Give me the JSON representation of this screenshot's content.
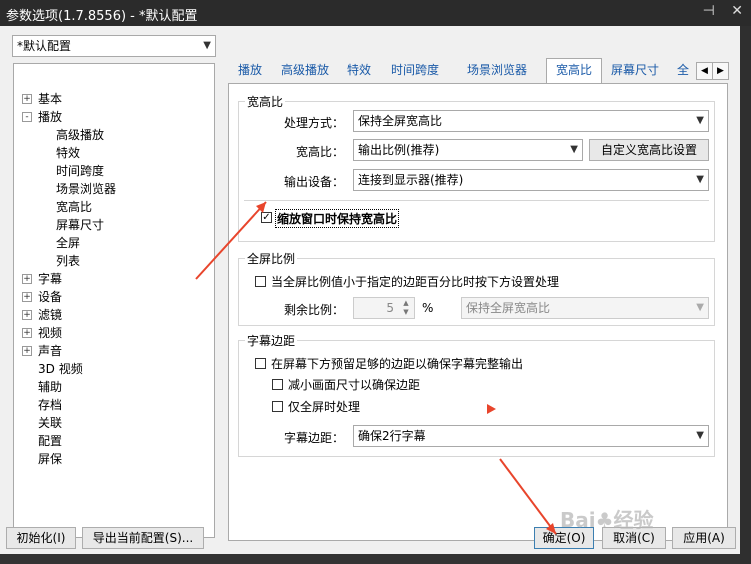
{
  "window": {
    "title": "参数选项(1.7.8556) - *默认配置",
    "pin_icon": "pin-icon",
    "close_icon": "close-icon"
  },
  "profile": {
    "selected": "*默认配置"
  },
  "tree": [
    {
      "label": "基本",
      "expander": "+"
    },
    {
      "label": "播放",
      "expander": "-"
    },
    {
      "label": "高级播放"
    },
    {
      "label": "特效"
    },
    {
      "label": "时间跨度"
    },
    {
      "label": "场景浏览器"
    },
    {
      "label": "宽高比"
    },
    {
      "label": "屏幕尺寸"
    },
    {
      "label": "全屏"
    },
    {
      "label": "列表"
    },
    {
      "label": "字幕",
      "expander": "+"
    },
    {
      "label": "设备",
      "expander": "+"
    },
    {
      "label": "滤镜",
      "expander": "+"
    },
    {
      "label": "视频",
      "expander": "+"
    },
    {
      "label": "声音",
      "expander": "+"
    },
    {
      "label": "3D 视频"
    },
    {
      "label": "辅助"
    },
    {
      "label": "存档"
    },
    {
      "label": "关联"
    },
    {
      "label": "配置"
    },
    {
      "label": "屏保"
    }
  ],
  "tabs": [
    "播放",
    "高级播放",
    "特效",
    "时间跨度",
    "场景浏览器",
    "宽高比",
    "屏幕尺寸",
    "全"
  ],
  "active_tab": "宽高比",
  "aspect": {
    "group_title": "宽高比",
    "method_label": "处理方式：",
    "method_value": "保持全屏宽高比",
    "ratio_label": "宽高比：",
    "ratio_value": "输出比例(推荐)",
    "custom_button": "自定义宽高比设置",
    "device_label": "输出设备：",
    "device_value": "连接到显示器(推荐)",
    "keep_on_resize": "缩放窗口时保持宽高比",
    "keep_on_resize_checked": true
  },
  "fullscreen": {
    "group_title": "全屏比例",
    "threshold_checkbox": "当全屏比例值小于指定的边距百分比时按下方设置处理",
    "remain_label": "剩余比例：",
    "remain_value": "5",
    "percent": "%",
    "mode_value": "保持全屏宽高比"
  },
  "subtitle_margin": {
    "group_title": "字幕边距",
    "reserve_checkbox": "在屏幕下方预留足够的边距以确保字幕完整输出",
    "shrink_checkbox": "减小画面尺寸以确保边距",
    "fullscreen_only_checkbox": "仅全屏时处理",
    "margin_label": "字幕边距：",
    "margin_value": "确保2行字幕"
  },
  "buttons": {
    "init": "初始化(I)",
    "export": "导出当前配置(S)...",
    "ok": "确定(O)",
    "cancel": "取消(C)",
    "apply": "应用(A)"
  },
  "colors": {
    "accent": "#1a5aa8",
    "annotation": "#e8452c"
  }
}
